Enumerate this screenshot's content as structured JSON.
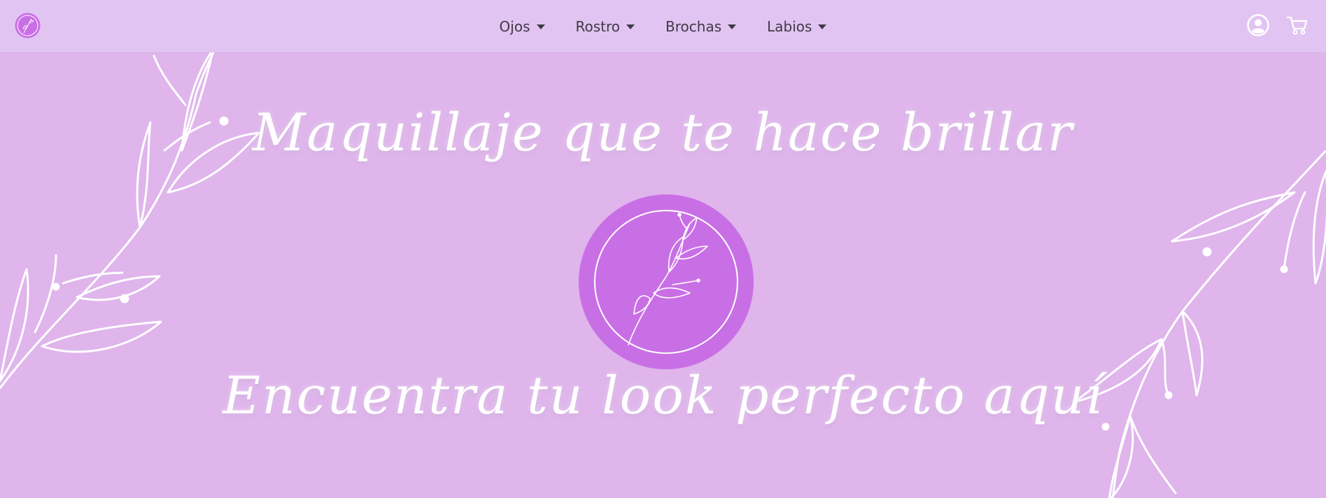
{
  "navbar": {
    "brand_icon": "leaf-circle-logo",
    "items": [
      {
        "label": "Ojos",
        "icon": "caret-down-icon"
      },
      {
        "label": "Rostro",
        "icon": "caret-down-icon"
      },
      {
        "label": "Brochas",
        "icon": "caret-down-icon"
      },
      {
        "label": "Labios",
        "icon": "caret-down-icon"
      }
    ],
    "right_icons": [
      "user-account-icon",
      "shopping-cart-icon"
    ]
  },
  "hero": {
    "headline": "Maquillaje que te hace brillar",
    "subheadline": "Encuentra tu look perfecto aquí",
    "emblem_icon": "leaf-circle-emblem",
    "decorations": [
      "leaf-branch-left",
      "leaf-branch-right"
    ]
  },
  "colors": {
    "navbar_bg": "#e2c4f2",
    "hero_bg": "#dfb5ec",
    "emblem_fill": "#c96fe6",
    "text_nav": "#3f3a45",
    "script_text": "#ffffff"
  }
}
